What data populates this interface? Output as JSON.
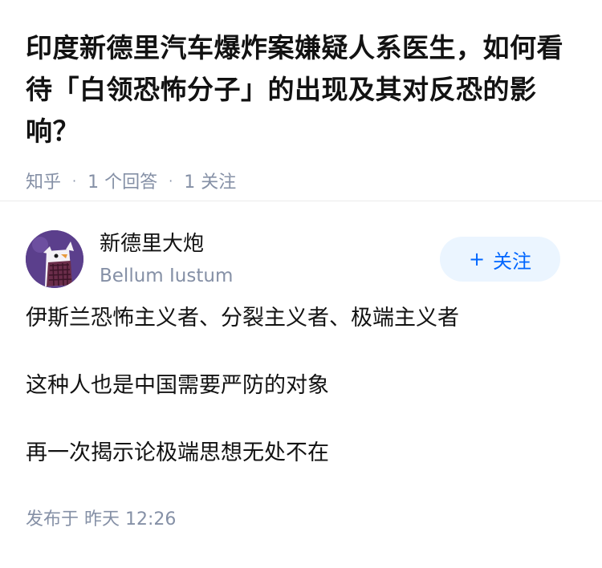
{
  "question": {
    "title": "印度新德里汽车爆炸案嫌疑人系医生，如何看待「白领恐怖分子」的出现及其对反恐的影响？",
    "source": "知乎",
    "answer_count": "1 个回答",
    "follow_count": "1 关注"
  },
  "answer": {
    "author": {
      "name": "新德里大炮",
      "bio": "Bellum Iustum",
      "avatar_icon": "avatar-illustration"
    },
    "follow_button": {
      "icon": "plus-icon",
      "icon_glyph": "+",
      "label": "关注",
      "accent_color": "#0066ff",
      "background": "#ebf5ff"
    },
    "paragraphs": [
      "伊斯兰恐怖主义者、分裂主义者、极端主义者",
      "这种人也是中国需要严防的对象",
      "再一次揭示论极端思想无处不在"
    ],
    "published": "发布于  昨天 12:26"
  }
}
